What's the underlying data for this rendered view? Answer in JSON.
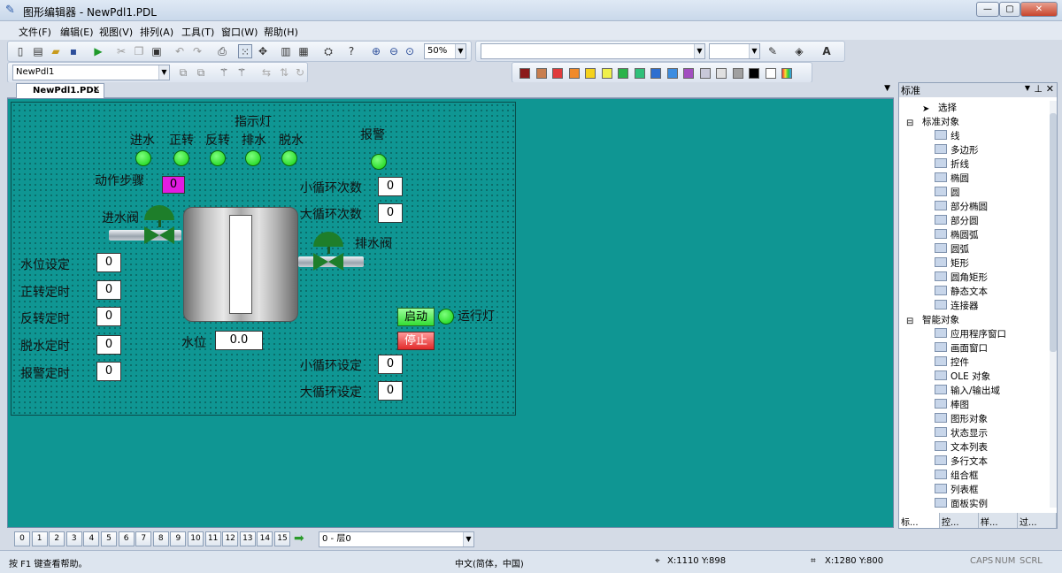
{
  "window": {
    "title": "图形编辑器 - NewPdl1.PDL"
  },
  "menu": [
    "文件(F)",
    "编辑(E)",
    "视图(V)",
    "排列(A)",
    "工具(T)",
    "窗口(W)",
    "帮助(H)"
  ],
  "toolbar": {
    "zoom": "50%",
    "object_combo": "NewPdl1"
  },
  "colors": {
    "canvas": "#0f9693",
    "lamp": "#22dd22",
    "valve": "#1e7e2a",
    "start": "#44ee44",
    "stop": "#ee2a2a",
    "step": "#e21be2"
  },
  "palette": [
    "#8b1a1a",
    "#c87e4e",
    "#e03b3b",
    "#f08a2a",
    "#f5d21c",
    "#eff04a",
    "#2bb34a",
    "#30c07a",
    "#2e6fd0",
    "#3d8de0",
    "#a24fc0",
    "#c8c8d8",
    "#e0e0e0",
    "#a0a0a0",
    "#000000",
    "#ffffff"
  ],
  "doc_tab": {
    "label": "NewPdl1.PDL"
  },
  "scada": {
    "indicator_title": "指示灯",
    "lamps": [
      "进水",
      "正转",
      "反转",
      "排水",
      "脱水"
    ],
    "alarm": "报警",
    "step_label": "动作步骤",
    "step_value": "0",
    "inlet_valve": "进水阀",
    "drain_valve": "排水阀",
    "small_cycle_count": "小循环次数",
    "small_cycle_count_value": "0",
    "big_cycle_count": "大循环次数",
    "big_cycle_count_value": "0",
    "settings": [
      {
        "label": "水位设定",
        "value": "0"
      },
      {
        "label": "正转定时",
        "value": "0"
      },
      {
        "label": "反转定时",
        "value": "0"
      },
      {
        "label": "脱水定时",
        "value": "0"
      },
      {
        "label": "报警定时",
        "value": "0"
      }
    ],
    "water_level_label": "水位",
    "water_level_value": "0.0",
    "start_button": "启动",
    "stop_button": "停止",
    "run_lamp": "运行灯",
    "small_cycle_set": "小循环设定",
    "small_cycle_set_value": "0",
    "big_cycle_set": "大循环设定",
    "big_cycle_set_value": "0"
  },
  "panel": {
    "title": "标准",
    "select": "选择",
    "standard_group": "标准对象",
    "standard_items": [
      "线",
      "多边形",
      "折线",
      "椭圆",
      "圆",
      "部分椭圆",
      "部分圆",
      "椭圆弧",
      "圆弧",
      "矩形",
      "圆角矩形",
      "静态文本",
      "连接器"
    ],
    "smart_group": "智能对象",
    "smart_items": [
      "应用程序窗口",
      "画面窗口",
      "控件",
      "OLE 对象",
      "输入/输出域",
      "棒图",
      "图形对象",
      "状态显示",
      "文本列表",
      "多行文本",
      "组合框",
      "列表框",
      "面板实例"
    ],
    "tabs": [
      "标...",
      "控...",
      "样...",
      "过..."
    ]
  },
  "layers": {
    "numbers": [
      "0",
      "1",
      "2",
      "3",
      "4",
      "5",
      "6",
      "7",
      "8",
      "9",
      "10",
      "11",
      "12",
      "13",
      "14",
      "15"
    ],
    "current": "0 - 层0"
  },
  "status": {
    "help": "按 F1 键查看帮助。",
    "lang": "中文(简体，中国)",
    "pos": "X:1110 Y:898",
    "size": "X:1280 Y:800",
    "caps": "CAPS",
    "num": "NUM",
    "scrl": "SCRL"
  }
}
